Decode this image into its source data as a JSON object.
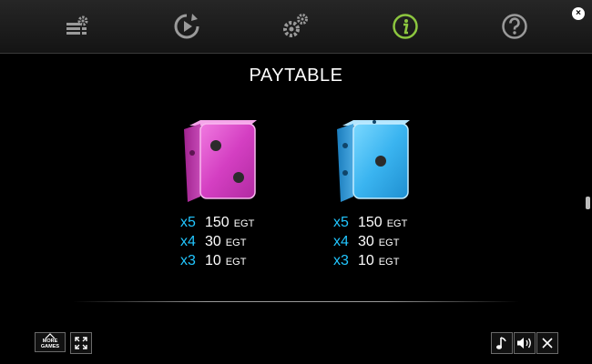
{
  "top_nav": {
    "items": [
      {
        "name": "paytable-settings-icon",
        "active": false
      },
      {
        "name": "autoplay-icon",
        "active": false
      },
      {
        "name": "settings-icon",
        "active": false
      },
      {
        "name": "info-icon",
        "active": true
      },
      {
        "name": "help-icon",
        "active": false
      }
    ],
    "active_color": "#8cc63f",
    "icon_color": "#9a9a9a",
    "close_glyph": "×"
  },
  "title": "PAYTABLE",
  "symbols": [
    {
      "name": "pink-die",
      "color": "#e040c8",
      "pays": [
        {
          "mult": "x5",
          "amount": "150",
          "currency": "EGT"
        },
        {
          "mult": "x4",
          "amount": "30",
          "currency": "EGT"
        },
        {
          "mult": "x3",
          "amount": "10",
          "currency": "EGT"
        }
      ]
    },
    {
      "name": "blue-die",
      "color": "#3ab4f0",
      "pays": [
        {
          "mult": "x5",
          "amount": "150",
          "currency": "EGT"
        },
        {
          "mult": "x4",
          "amount": "30",
          "currency": "EGT"
        },
        {
          "mult": "x3",
          "amount": "10",
          "currency": "EGT"
        }
      ]
    }
  ],
  "bottom_bar": {
    "more_games_line1": "MORE",
    "more_games_line2": "GAMES"
  },
  "colors": {
    "multiplier": "#21c6ff",
    "background": "#000000"
  }
}
